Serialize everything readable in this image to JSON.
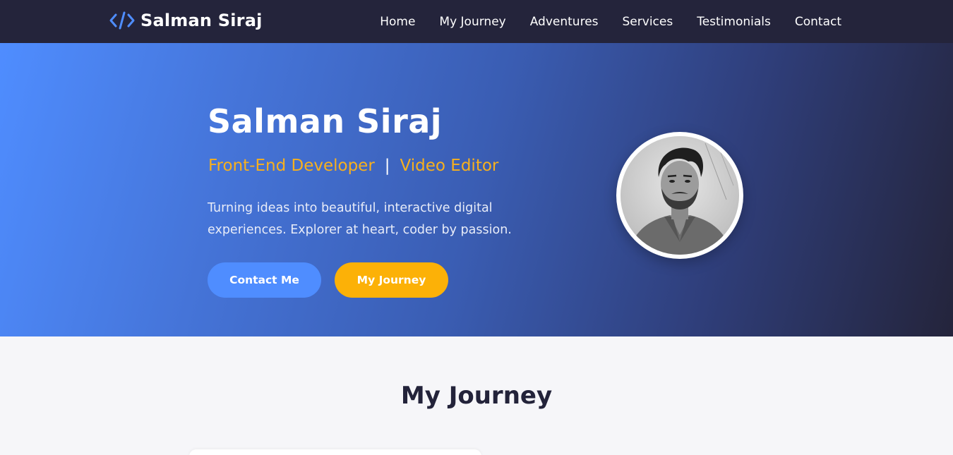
{
  "nav": {
    "brand": "Salman Siraj",
    "brand_icon": "code-icon",
    "links": [
      "Home",
      "My Journey",
      "Adventures",
      "Services",
      "Testimonials",
      "Contact"
    ]
  },
  "hero": {
    "title": "Salman Siraj",
    "role_1": "Front-End Developer",
    "separator": "|",
    "role_2": "Video Editor",
    "description": "Turning ideas into beautiful, interactive digital experiences. Explorer at heart, coder by passion.",
    "contact_button": "Contact Me",
    "journey_button": "My Journey",
    "avatar_alt": "profile-photo"
  },
  "journey": {
    "title": "My Journey"
  },
  "colors": {
    "nav_bg": "#24243b",
    "accent_blue": "#4f8dff",
    "accent_yellow": "#fcb107",
    "role_color": "#f7b01e",
    "section_bg": "#f6f6f9"
  }
}
